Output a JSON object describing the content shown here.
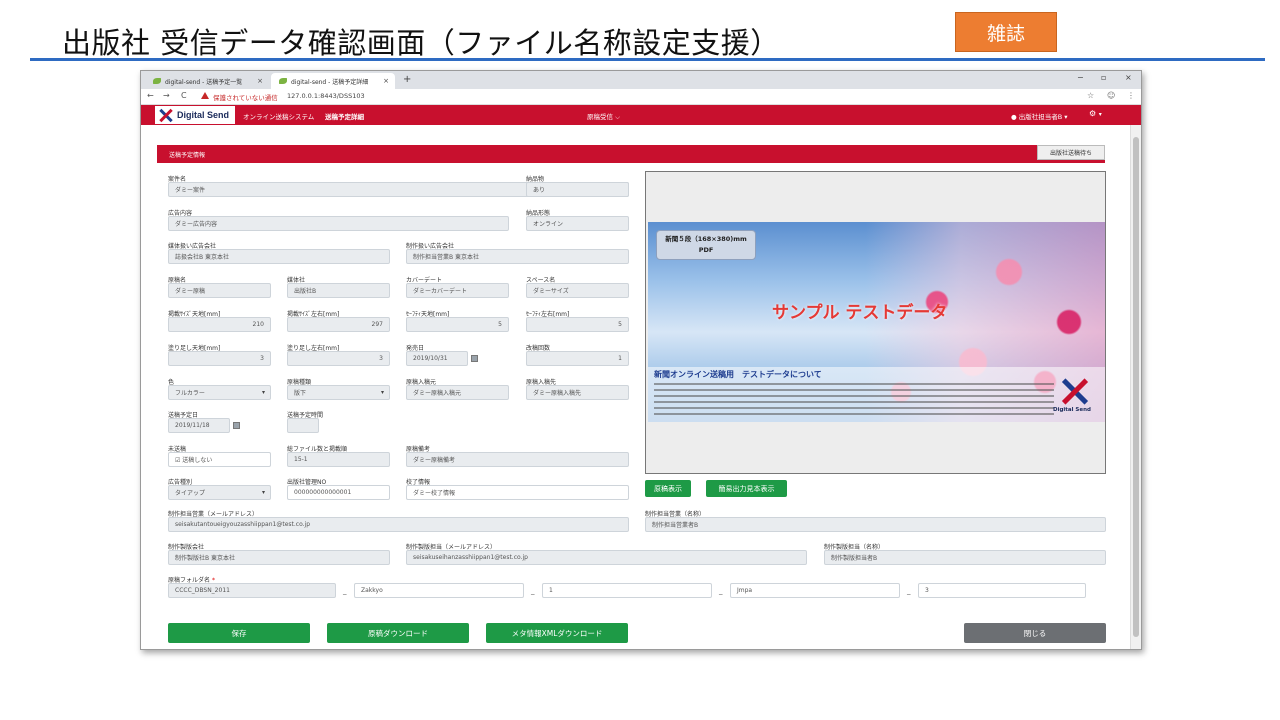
{
  "slide": {
    "title": "出版社 受信データ確認画面（ファイル名称設定支援）",
    "tag": "雑誌"
  },
  "browser": {
    "tabs": [
      {
        "label": "digital-send - 送稿予定一覧"
      },
      {
        "label": "digital-send - 送稿予定詳細"
      }
    ],
    "new_tab": "+",
    "close_glyph": "×",
    "win_min": "−",
    "win_max": "▫",
    "win_close": "×",
    "nav_back": "←",
    "nav_forward": "→",
    "nav_reload": "C",
    "security_warning": "保護されていない通信",
    "url": "127.0.0.1:8443/DSS103",
    "star": "☆",
    "account_icon": "☺",
    "menu_icon": "⋮"
  },
  "app": {
    "logo": "Digital Send",
    "system_name": "オンライン送稿システム",
    "page_name": "送稿予定詳細",
    "center_menu": "原稿受信",
    "center_caret": "⌵",
    "user": "出版社担当者B",
    "user_caret": "▾",
    "gear": "⚙",
    "gear_caret": "▾"
  },
  "panel": {
    "title": "送稿予定情報",
    "status_button": "出版社送稿待ち"
  },
  "fields": {
    "case_name": {
      "label": "案件名",
      "value": "ダミー案件"
    },
    "delivery": {
      "label": "納品物",
      "value": "あり"
    },
    "ad_content": {
      "label": "広告内容",
      "value": "ダミー広告内容"
    },
    "delivery_form": {
      "label": "納品形態",
      "value": "オンライン"
    },
    "media_agency": {
      "label": "媒体扱い広告会社",
      "value": "誌扱会社B 東京本社"
    },
    "production_agency": {
      "label": "制作扱い広告会社",
      "value": "制作担当営業B 東京本社"
    },
    "manuscript_name": {
      "label": "原稿名",
      "value": "ダミー原稿"
    },
    "publisher": {
      "label": "媒体社",
      "value": "出版社B"
    },
    "cover_date": {
      "label": "カバーデート",
      "value": "ダミーカバーデート"
    },
    "space_name": {
      "label": "スペース名",
      "value": "ダミーサイズ"
    },
    "print_size_h": {
      "label": "掲載ｻｲｽﾞ天地[mm]",
      "value": "210"
    },
    "print_size_w": {
      "label": "掲載ｻｲｽﾞ左右[mm]",
      "value": "297"
    },
    "safety_h": {
      "label": "ｾｰﾌﾃｨ天地[mm]",
      "value": "5"
    },
    "safety_w": {
      "label": "ｾｰﾌﾃｨ左右[mm]",
      "value": "5"
    },
    "bleed_h": {
      "label": "塗り足し天地[mm]",
      "value": "3"
    },
    "bleed_w": {
      "label": "塗り足し左右[mm]",
      "value": "3"
    },
    "release_date": {
      "label": "発売日",
      "value": "2019/10/31"
    },
    "revision_count": {
      "label": "改稿回数",
      "value": "1"
    },
    "color": {
      "label": "色",
      "value": "フルカラー",
      "caret": "▾"
    },
    "manuscript_type": {
      "label": "原稿種類",
      "value": "版下",
      "caret": "▾"
    },
    "original_from": {
      "label": "原稿入稿元",
      "value": "ダミー原稿入稿元"
    },
    "original_to": {
      "label": "原稿入稿先",
      "value": "ダミー原稿入稿先"
    },
    "send_date": {
      "label": "送稿予定日",
      "value": "2019/11/18"
    },
    "send_time": {
      "label": "送稿予定時間",
      "value": ""
    },
    "not_sent": {
      "label": "未送稿",
      "value": "☑ 送稿しない"
    },
    "file_count": {
      "label": "総ファイル数と掲載順",
      "value": "15-1"
    },
    "manuscript_note": {
      "label": "原稿備考",
      "value": "ダミー原稿備考"
    },
    "ad_type": {
      "label": "広告種別",
      "value": "タイアップ",
      "caret": "▾"
    },
    "publisher_mgmt_no": {
      "label": "出版社管理NO",
      "value": "000000000000001"
    },
    "proof_info": {
      "label": "校了情報",
      "value": "ダミー校了情報"
    },
    "sales_email": {
      "label": "制作担当営業（メールアドレス）",
      "value": "seisakutantoueigyouzasshiippan1@test.co.jp"
    },
    "sales_name": {
      "label": "制作担当営業（名称）",
      "value": "制作担当営業者B"
    },
    "plate_company": {
      "label": "制作製版会社",
      "value": "制作製版社B 東京本社"
    },
    "plate_email": {
      "label": "制作製版担当（メールアドレス）",
      "value": "seisakuseihanzasshiippan1@test.co.jp"
    },
    "plate_name": {
      "label": "制作製版担当（名称）",
      "value": "制作製版担当者B"
    },
    "folder": {
      "label": "原稿フォルダ名",
      "required": "*",
      "parts": [
        "CCCC_DBSN_2011",
        "Zakkyo",
        "1",
        "Jmpa",
        "3"
      ],
      "sep": "_"
    }
  },
  "preview": {
    "size_line1": "新聞５段（168×380)mm",
    "size_line2": "PDF",
    "sample_text": "サンプル テストデータ",
    "strip_title": "新聞オンライン送稿用　テストデータについて",
    "logo_text": "Digital Send",
    "btn_show": "原稿表示",
    "btn_simple": "簡易出力見本表示"
  },
  "actions": {
    "save": "保存",
    "download": "原稿ダウンロード",
    "xml_download": "メタ情報XMLダウンロード",
    "close": "閉じる"
  },
  "colors": {
    "brand_red": "#c8102e",
    "action_green": "#1e9a46",
    "slide_rule_blue": "#2e6bc2",
    "tag_orange": "#ed7d31"
  }
}
